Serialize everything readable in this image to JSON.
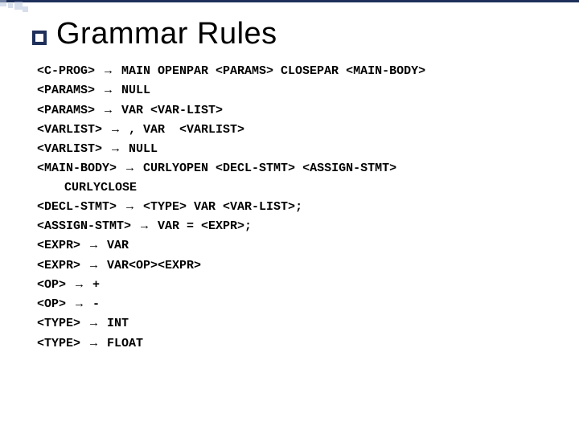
{
  "title": "Grammar Rules",
  "arrow": "→",
  "rules": [
    {
      "lhs": "<C-PROG>",
      "rhs": "MAIN OPENPAR <PARAMS> CLOSEPAR <MAIN-BODY>"
    },
    {
      "lhs": "<PARAMS>",
      "rhs": "NULL"
    },
    {
      "lhs": "<PARAMS>",
      "rhs": "VAR <VAR-LIST>"
    },
    {
      "lhs": "<VARLIST>",
      "rhs": ", VAR  <VARLIST>"
    },
    {
      "lhs": "<VARLIST>",
      "rhs": "NULL"
    },
    {
      "lhs": "<MAIN-BODY>",
      "rhs": "CURLYOPEN <DECL-STMT> <ASSIGN-STMT>",
      "cont": "CURLYCLOSE"
    },
    {
      "lhs": "<DECL-STMT>",
      "rhs": "<TYPE> VAR <VAR-LIST>;"
    },
    {
      "lhs": "<ASSIGN-STMT>",
      "rhs": "VAR = <EXPR>;"
    },
    {
      "lhs": "<EXPR>",
      "rhs": "VAR"
    },
    {
      "lhs": "<EXPR>",
      "rhs": "VAR<OP><EXPR>"
    },
    {
      "lhs": "<OP>",
      "rhs": "+"
    },
    {
      "lhs": "<OP>",
      "rhs": "-"
    },
    {
      "lhs": "<TYPE>",
      "rhs": "INT"
    },
    {
      "lhs": "<TYPE>",
      "rhs": "FLOAT"
    }
  ]
}
